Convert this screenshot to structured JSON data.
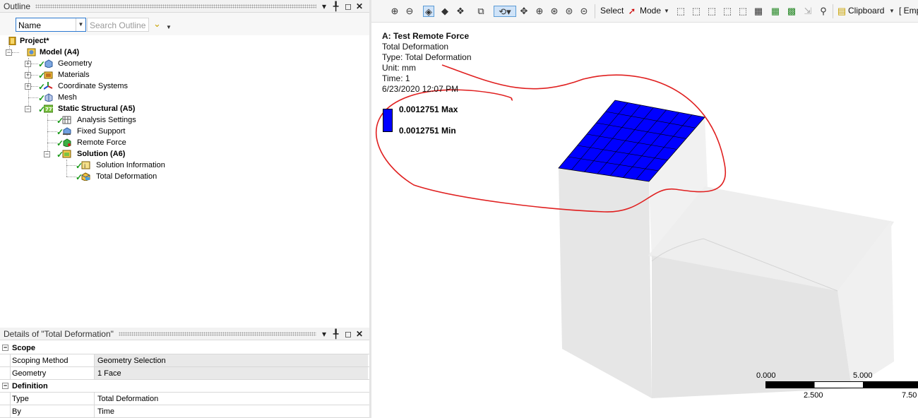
{
  "outline": {
    "title": "Outline",
    "pin": "▕",
    "filter_select": "Name",
    "search_placeholder": "Search Outline",
    "tree": {
      "project": "Project*",
      "model": "Model (A4)",
      "geometry": "Geometry",
      "materials": "Materials",
      "coordinate_systems": "Coordinate Systems",
      "mesh": "Mesh",
      "static_structural": "Static Structural (A5)",
      "analysis_settings": "Analysis Settings",
      "fixed_support": "Fixed Support",
      "remote_force": "Remote Force",
      "solution": "Solution (A6)",
      "solution_information": "Solution Information",
      "total_deformation": "Total Deformation"
    }
  },
  "details": {
    "title": "Details of \"Total Deformation\"",
    "sections": [
      {
        "name": "Scope",
        "rows": [
          {
            "label": "Scoping Method",
            "value": "Geometry Selection"
          },
          {
            "label": "Geometry",
            "value": "1 Face"
          }
        ]
      },
      {
        "name": "Definition",
        "rows": [
          {
            "label": "Type",
            "value": "Total Deformation"
          },
          {
            "label": "By",
            "value": "Time"
          }
        ]
      }
    ]
  },
  "toolbar": {
    "select_label": "Select",
    "mode_label": "Mode",
    "clipboard_label": "Clipboard",
    "empty_label": "[ Emp"
  },
  "viewport": {
    "title": "A: Test Remote Force",
    "type_line": "Total Deformation",
    "type_full": "Type: Total Deformation",
    "unit": "Unit: mm",
    "time": "Time: 1",
    "date": "6/23/2020 12:07 PM",
    "legend_max": "0.0012751 Max",
    "legend_min": "0.0012751 Min",
    "legend_color": "#0000ff",
    "scale_labels": {
      "a": "0.000",
      "b": "5.000",
      "c": "2.500",
      "d": "7.50"
    }
  },
  "annotation_color": "#e02020"
}
